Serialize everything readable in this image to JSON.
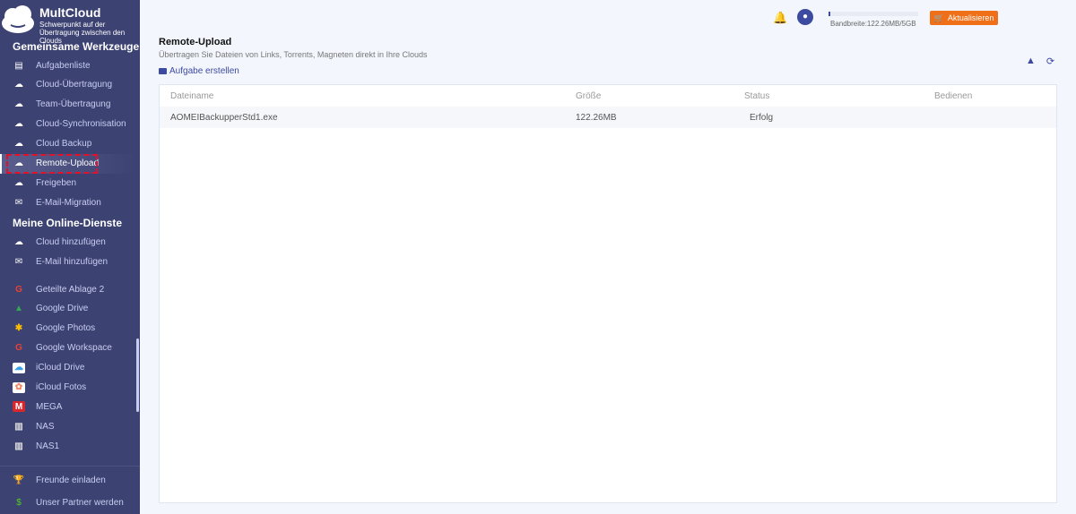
{
  "brand": {
    "name": "MultCloud",
    "tagline": "Schwerpunkt auf der Übertragung zwischen den Clouds"
  },
  "sidebar": {
    "section1": "Gemeinsame Werkzeuge",
    "tools": [
      {
        "label": "Aufgabenliste",
        "icon": "clipboard-icon"
      },
      {
        "label": "Cloud-Übertragung",
        "icon": "cloud-transfer-icon"
      },
      {
        "label": "Team-Übertragung",
        "icon": "team-transfer-icon"
      },
      {
        "label": "Cloud-Synchronisation",
        "icon": "cloud-sync-icon"
      },
      {
        "label": "Cloud Backup",
        "icon": "cloud-backup-icon"
      },
      {
        "label": "Remote-Upload",
        "icon": "cloud-upload-icon",
        "active": true
      },
      {
        "label": "Freigeben",
        "icon": "share-icon"
      },
      {
        "label": "E-Mail-Migration",
        "icon": "email-migration-icon"
      }
    ],
    "section2": "Meine Online-Dienste",
    "services": [
      {
        "label": "Cloud hinzufügen",
        "icon": "cloud-add-icon"
      },
      {
        "label": "E-Mail hinzufügen",
        "icon": "email-add-icon"
      },
      {
        "label": "Geteilte Ablage 2",
        "icon": "google-icon"
      },
      {
        "label": "Google Drive",
        "icon": "google-drive-icon"
      },
      {
        "label": "Google Photos",
        "icon": "google-photos-icon"
      },
      {
        "label": "Google Workspace",
        "icon": "google-icon"
      },
      {
        "label": "iCloud Drive",
        "icon": "icloud-icon"
      },
      {
        "label": "iCloud Fotos",
        "icon": "icloud-photos-icon"
      },
      {
        "label": "MEGA",
        "icon": "mega-icon"
      },
      {
        "label": "NAS",
        "icon": "nas-icon"
      },
      {
        "label": "NAS1",
        "icon": "nas-icon"
      }
    ],
    "bottom": [
      {
        "label": "Freunde einladen",
        "icon": "trophy-icon"
      },
      {
        "label": "Unser Partner werden",
        "icon": "dollar-icon"
      }
    ]
  },
  "header": {
    "bandwidth_text": "Bandbreite:122.26MB/5GB",
    "bandwidth_used_fraction": 0.024,
    "upgrade_label": "Aktualisieren"
  },
  "page": {
    "title": "Remote-Upload",
    "subtitle": "Übertragen Sie Dateien von Links, Torrents, Magneten direkt in Ihre Clouds",
    "create_label": "Aufgabe erstellen"
  },
  "table": {
    "headers": [
      "Dateiname",
      "Größe",
      "Status",
      "Bedienen"
    ],
    "rows": [
      {
        "name": "AOMEIBackupperStd1.exe",
        "size": "122.26MB",
        "status": "Erfolg",
        "action": ""
      }
    ]
  },
  "colors": {
    "sidebar": "#3c4272",
    "accent": "#3c4aa0",
    "upgrade": "#f07019",
    "highlight": "#e5102a"
  }
}
